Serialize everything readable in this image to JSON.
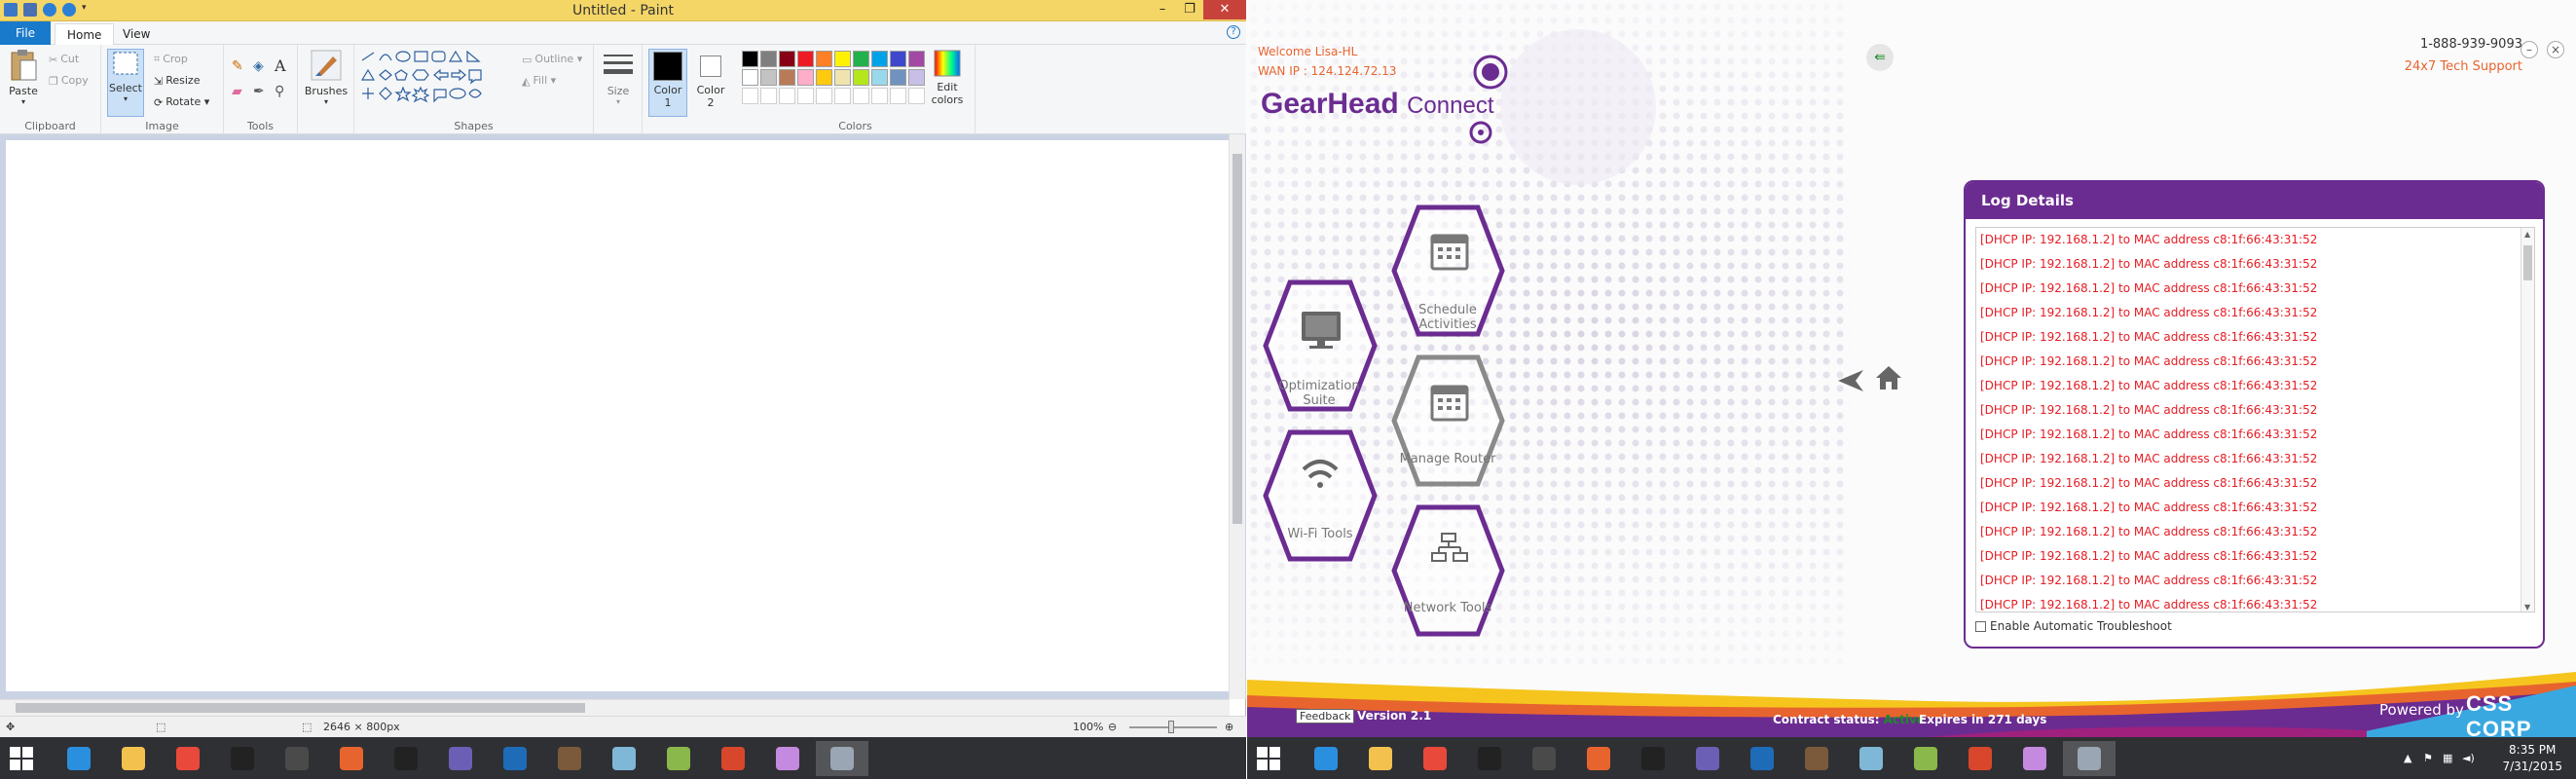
{
  "paint": {
    "title": "Untitled - Paint",
    "menu": {
      "file": "File",
      "home": "Home",
      "view": "View",
      "help": "?"
    },
    "clipboard": {
      "paste": "Paste",
      "cut": "Cut",
      "copy": "Copy",
      "label": "Clipboard"
    },
    "image": {
      "select": "Select",
      "crop": "Crop",
      "resize": "Resize",
      "rotate": "Rotate",
      "label": "Image"
    },
    "tools": {
      "label": "Tools",
      "text_tool": "A"
    },
    "brushes": {
      "label": "Brushes"
    },
    "shapes": {
      "label": "Shapes",
      "outline": "Outline",
      "fill": "Fill"
    },
    "size": {
      "label": "Size"
    },
    "color1": {
      "label": "Color",
      "num": "1"
    },
    "color2": {
      "label": "Color",
      "num": "2"
    },
    "colors": {
      "label": "Colors",
      "edit_label": "Edit",
      "edit_label2": "colors",
      "palette_row1": [
        "#000000",
        "#7f7f7f",
        "#880015",
        "#ed1c24",
        "#ff7f27",
        "#fff200",
        "#22b14c",
        "#00a2e8",
        "#3f48cc",
        "#a349a4"
      ],
      "palette_row2": [
        "#ffffff",
        "#c3c3c3",
        "#b97a57",
        "#ffaec9",
        "#ffc90e",
        "#efe4b0",
        "#b5e61d",
        "#99d9ea",
        "#7092be",
        "#c8bfe7"
      ]
    },
    "status": {
      "dimensions": "2646 × 800px",
      "zoom": "100%"
    }
  },
  "gearhead": {
    "welcome": "Welcome Lisa-HL",
    "wan_ip": "WAN IP : 124.124.72.13",
    "logo_main": "GearHead",
    "logo_sub": "Connect",
    "phone": "1-888-939-9093",
    "support": "24x7 Tech Support",
    "minimize": "–",
    "close": "×",
    "tiles": {
      "schedule": {
        "line1": "Schedule",
        "line2": "Activities"
      },
      "optimization": {
        "line1": "Optimization",
        "line2": "Suite"
      },
      "manage_router": "Manage Router",
      "wifi_tools": "Wi-Fi Tools",
      "network_tools": "Network Tools"
    },
    "log": {
      "title": "Log Details",
      "lines": [
        "[DHCP IP: 192.168.1.2] to MAC address c8:1f:66:43:31:52",
        "[DHCP IP: 192.168.1.2] to MAC address c8:1f:66:43:31:52",
        "[DHCP IP: 192.168.1.2] to MAC address c8:1f:66:43:31:52",
        "[DHCP IP: 192.168.1.2] to MAC address c8:1f:66:43:31:52",
        "[DHCP IP: 192.168.1.2] to MAC address c8:1f:66:43:31:52",
        "[DHCP IP: 192.168.1.2] to MAC address c8:1f:66:43:31:52",
        "[DHCP IP: 192.168.1.2] to MAC address c8:1f:66:43:31:52",
        "[DHCP IP: 192.168.1.2] to MAC address c8:1f:66:43:31:52",
        "[DHCP IP: 192.168.1.2] to MAC address c8:1f:66:43:31:52",
        "[DHCP IP: 192.168.1.2] to MAC address c8:1f:66:43:31:52",
        "[DHCP IP: 192.168.1.2] to MAC address c8:1f:66:43:31:52",
        "[DHCP IP: 192.168.1.2] to MAC address c8:1f:66:43:31:52",
        "[DHCP IP: 192.168.1.2] to MAC address c8:1f:66:43:31:52",
        "[DHCP IP: 192.168.1.2] to MAC address c8:1f:66:43:31:52",
        "[DHCP IP: 192.168.1.2] to MAC address c8:1f:66:43:31:52",
        "[DHCP IP: 192.168.1.2] to MAC address c8:1f:66:43:31:52"
      ],
      "auto_troubleshoot": "Enable Automatic Troubleshoot"
    },
    "footer": {
      "feedback": "Feedback",
      "version": "Version 2.1",
      "contract_label": "Contract status:",
      "contract_state": "Active",
      "expires": "Expires in 271 days",
      "powered_by": "Powered by",
      "vendor": "CSS CORP"
    },
    "brand_purple": "#6b2c91",
    "accent_orange": "#e8642e"
  },
  "taskbar": {
    "clock_time": "8:35 PM",
    "clock_date": "7/31/2015",
    "apps": [
      "internet-explorer",
      "file-explorer",
      "chrome",
      "command-prompt",
      "sublime-text",
      "firefox",
      "command-prompt",
      "remote-tool",
      "lync",
      "archive-tool",
      "notes",
      "paint",
      "office-tool",
      "media-player",
      "gearhead-connect"
    ]
  }
}
